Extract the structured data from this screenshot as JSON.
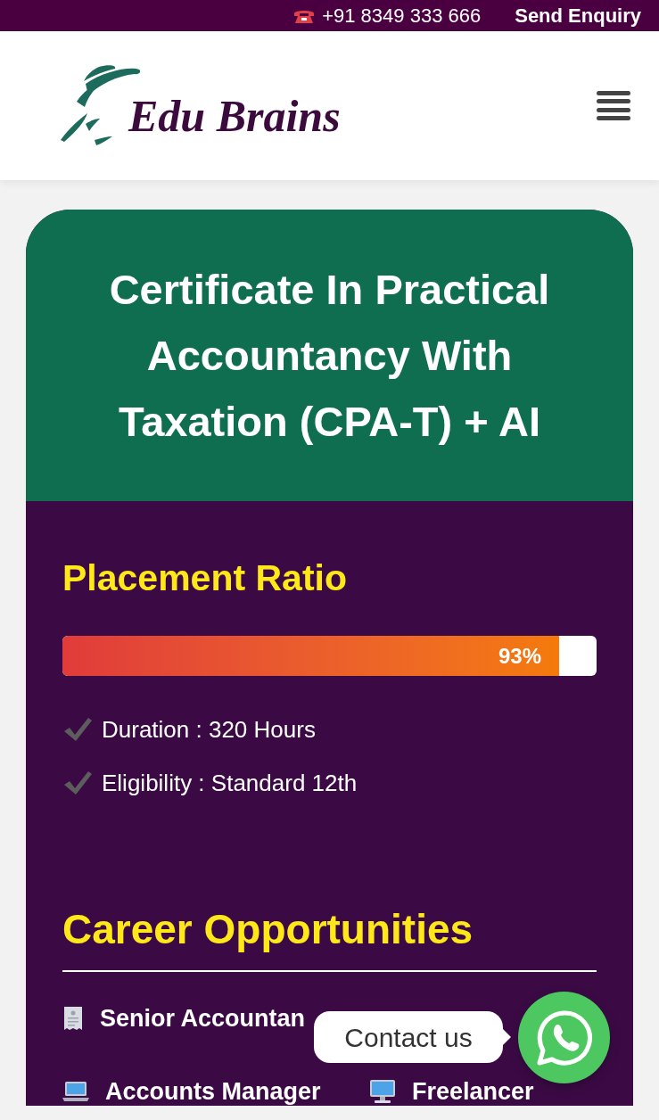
{
  "top_bar": {
    "phone": "+91 8349 333 666",
    "enquiry": "Send Enquiry"
  },
  "header": {
    "logo_text": "Edu Brains"
  },
  "course": {
    "title": "Certificate In Practical Accountancy With Taxation (CPA-T) + AI",
    "placement": {
      "heading": "Placement Ratio",
      "level": 0.93,
      "reading": "93%"
    },
    "facts": [
      "Duration : 320 Hours",
      "Eligibility : Standard 12th"
    ],
    "careers": {
      "heading": "Career Opportunities",
      "items": [
        {
          "label": "Senior Accountan",
          "kind": "receipt"
        },
        {
          "label": "Accounts Manager",
          "kind": "laptop"
        },
        {
          "label": "Freelancer",
          "kind": "desktop"
        }
      ]
    }
  },
  "contact": {
    "label": "Contact us"
  }
}
